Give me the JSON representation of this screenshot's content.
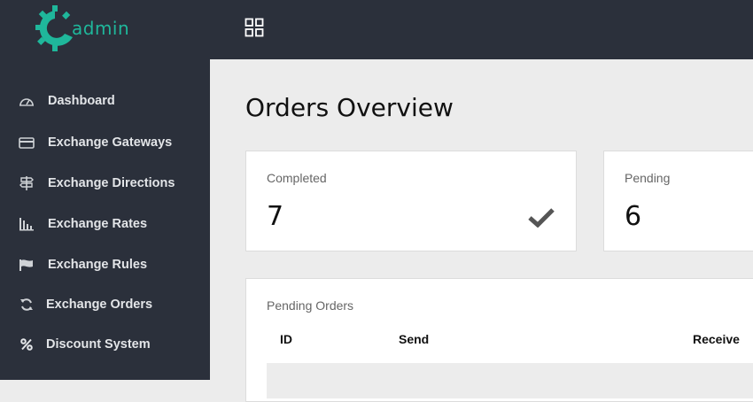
{
  "brand": {
    "logo_text": "admin",
    "accent": "#1fb79b"
  },
  "sidebar": {
    "items": [
      {
        "label": "Dashboard",
        "icon": "speedometer-icon"
      },
      {
        "label": "Exchange Gateways",
        "icon": "credit-card-icon"
      },
      {
        "label": "Exchange Directions",
        "icon": "signpost-icon"
      },
      {
        "label": "Exchange Rates",
        "icon": "bar-chart-icon"
      },
      {
        "label": "Exchange Rules",
        "icon": "flag-icon"
      },
      {
        "label": "Exchange Orders",
        "icon": "refresh-icon"
      },
      {
        "label": "Discount System",
        "icon": "percent-icon"
      }
    ]
  },
  "topbar": {
    "grid_icon": "apps-grid-icon"
  },
  "main": {
    "title": "Orders Overview",
    "cards": [
      {
        "label": "Completed",
        "value": "7",
        "icon": "check-icon"
      },
      {
        "label": "Pending",
        "value": "6"
      }
    ],
    "pending_orders": {
      "title": "Pending Orders",
      "columns": [
        "ID",
        "Send",
        "Receive"
      ]
    }
  }
}
